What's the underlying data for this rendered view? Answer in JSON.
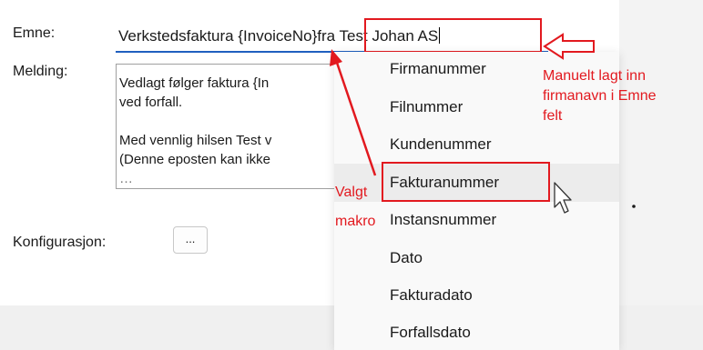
{
  "form": {
    "subject_label": "Emne:",
    "subject_text": "Verkstedsfaktura {InvoiceNo}fra Test Johan AS",
    "message_label": "Melding:",
    "message_lines": [
      "Vedlagt følger faktura {In",
      "ved forfall.",
      "",
      "Med vennlig hilsen Test v",
      "(Denne eposten kan ikke",
      "…"
    ],
    "config_label": "Konfigurasjon:",
    "config_button_label": "..."
  },
  "macro_menu": {
    "items": [
      "Firmanummer",
      "Filnummer",
      "Kundenummer",
      "Fakturanummer",
      "Instansnummer",
      "Dato",
      "Fakturadato",
      "Forfallsdato"
    ],
    "selected": "Fakturanummer"
  },
  "annotations": {
    "manual_note": [
      "Manuelt lagt inn",
      "firmanavn i Emne",
      "felt"
    ],
    "macro_note": [
      "Valgt",
      "makro"
    ]
  },
  "colors": {
    "annotation_red": "#e2191f",
    "focus_underline": "#1f5fbf"
  }
}
